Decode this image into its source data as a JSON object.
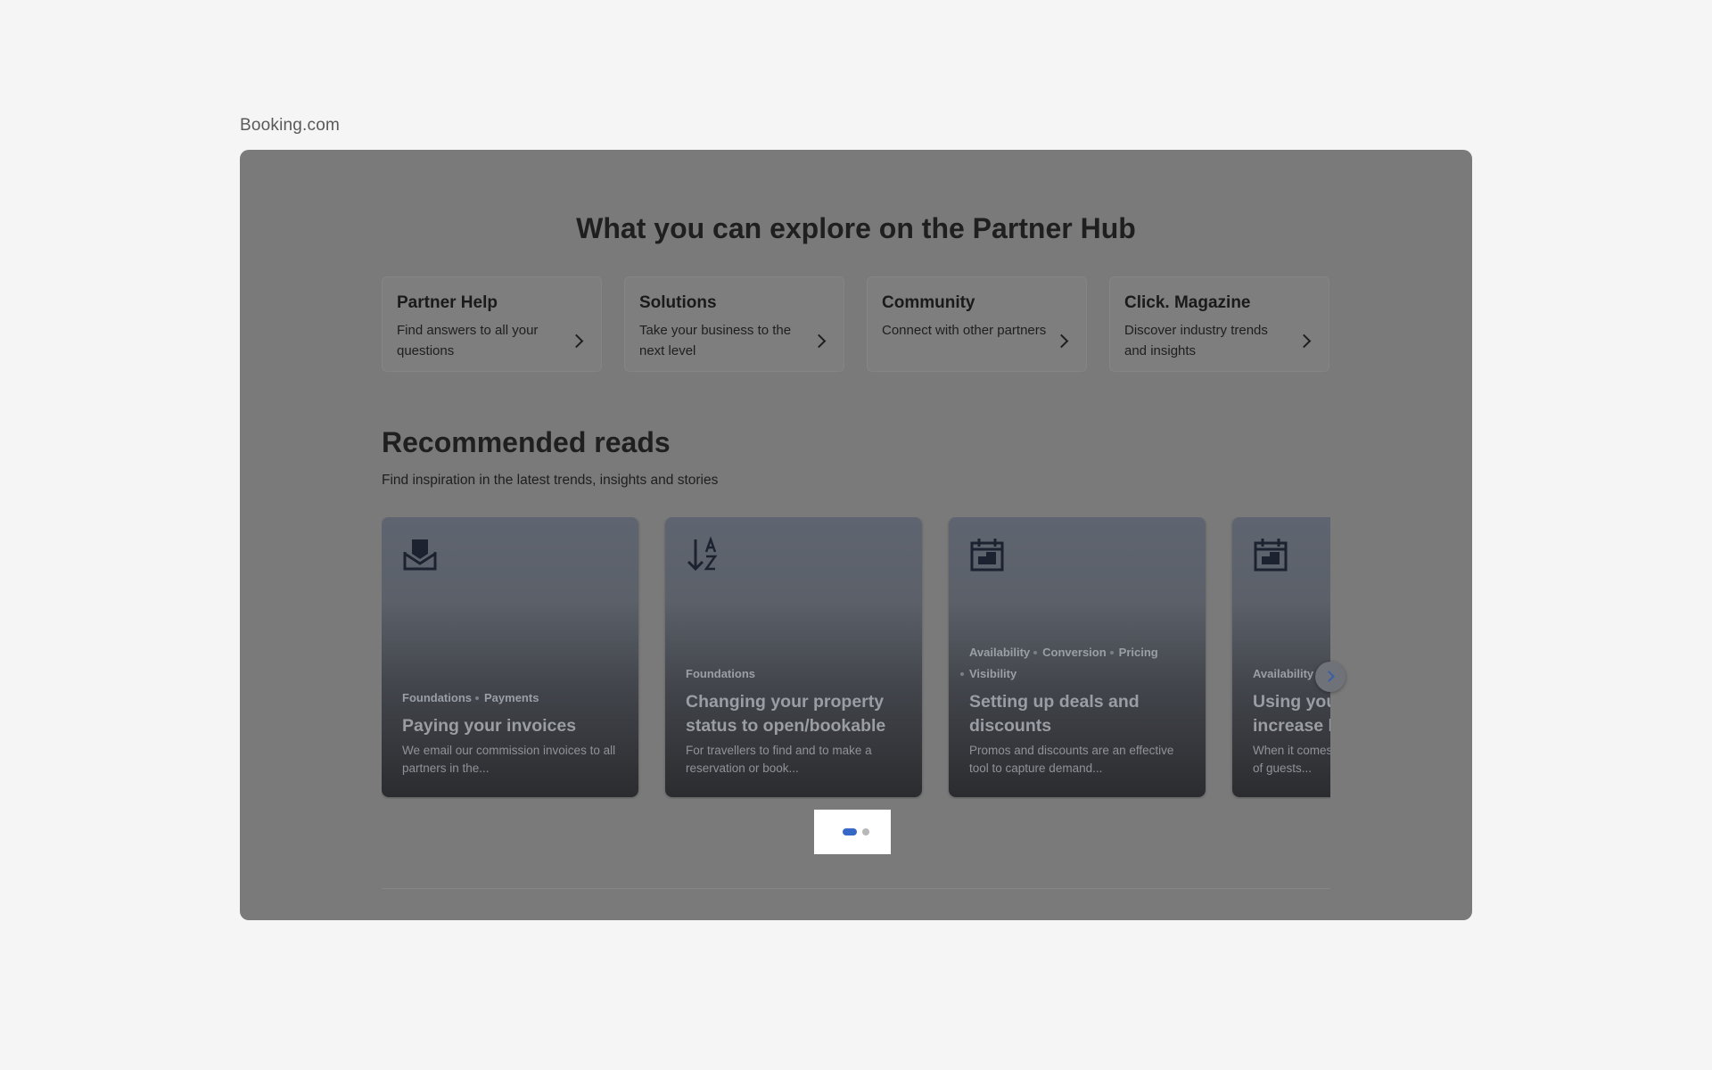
{
  "site_label": "Booking.com",
  "hero": {
    "title": "What you can explore on the Partner Hub"
  },
  "hub_cards": [
    {
      "title": "Partner Help",
      "desc": "Find answers to all your questions"
    },
    {
      "title": "Solutions",
      "desc": "Take your business to the next level"
    },
    {
      "title": "Community",
      "desc": "Connect with other partners"
    },
    {
      "title": "Click. Magazine",
      "desc": "Discover industry trends and insights"
    }
  ],
  "reads": {
    "title": "Recommended reads",
    "subtitle": "Find inspiration in the latest trends, insights and stories",
    "cards": [
      {
        "icon": "inbox-icon",
        "tags": [
          "Foundations",
          "Payments"
        ],
        "title": "Paying your invoices",
        "desc": "We email our commission invoices to all partners in the..."
      },
      {
        "icon": "sort-az-icon",
        "tags": [
          "Foundations"
        ],
        "title": "Changing your property status to open/bookable",
        "desc": "For travellers to find and to make a reservation or book..."
      },
      {
        "icon": "calendar-icon",
        "tags": [
          "Availability",
          "Conversion",
          "Pricing",
          "Visibility"
        ],
        "title": "Setting up deals and discounts",
        "desc": "Promos and discounts are an effective tool to capture demand..."
      },
      {
        "icon": "calendar-icon",
        "tags": [
          "Availability"
        ],
        "title": "Using your rate plans to increase bookings",
        "desc": "When it comes to increasing the number of guests..."
      }
    ]
  },
  "pagination": {
    "current": 1,
    "total": 2
  },
  "colors": {
    "overlay": "#7a7a7a",
    "accent": "#3868c7",
    "page_bg": "#f5f5f5"
  }
}
